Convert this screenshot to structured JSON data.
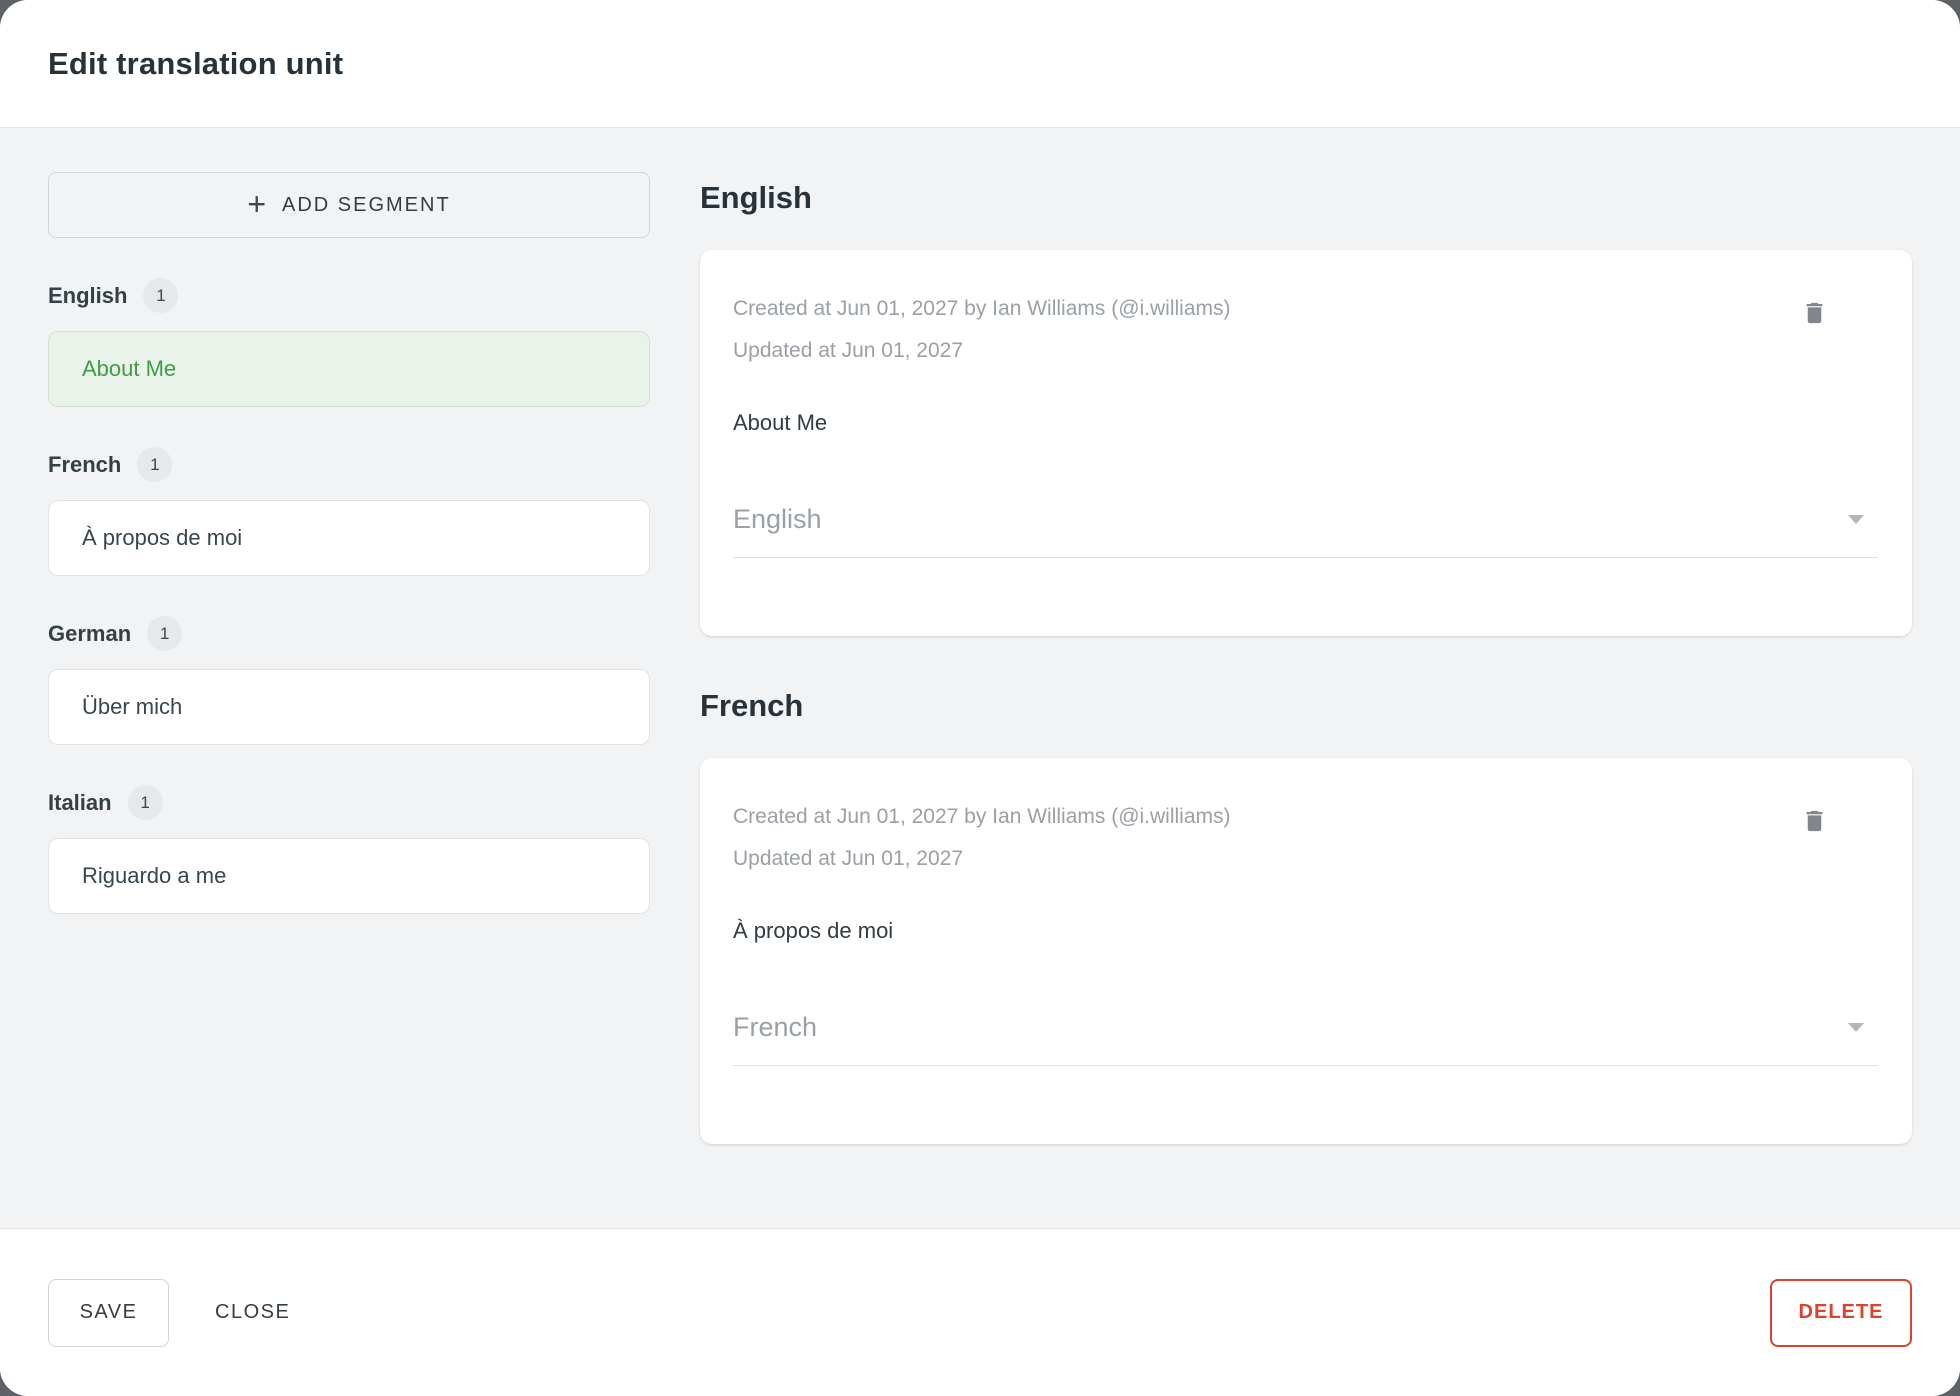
{
  "dialog": {
    "title": "Edit translation unit"
  },
  "sidebar": {
    "add_segment": {
      "icon": "+",
      "label": "ADD SEGMENT"
    },
    "groups": [
      {
        "language": "English",
        "count": "1",
        "segment": "About Me",
        "selected": true
      },
      {
        "language": "French",
        "count": "1",
        "segment": "À propos de moi",
        "selected": false
      },
      {
        "language": "German",
        "count": "1",
        "segment": "Über mich",
        "selected": false
      },
      {
        "language": "Italian",
        "count": "1",
        "segment": "Riguardo a me",
        "selected": false
      }
    ]
  },
  "main": {
    "sections": [
      {
        "heading": "English",
        "created_line": "Created at Jun 01, 2027 by Ian Williams (@i.williams)",
        "updated_line": "Updated at Jun 01, 2027",
        "text": "About Me",
        "language_select_value": "English"
      },
      {
        "heading": "French",
        "created_line": "Created at Jun 01, 2027 by Ian Williams (@i.williams)",
        "updated_line": "Updated at Jun 01, 2027",
        "text": "À propos de moi",
        "language_select_value": "French"
      }
    ]
  },
  "footer": {
    "save_label": "SAVE",
    "close_label": "CLOSE",
    "delete_label": "DELETE"
  },
  "colors": {
    "selected_segment_green": "#3f9d46",
    "selected_segment_bg": "#e9f3e9",
    "danger_red": "#d9432f",
    "body_gray": "#f1f3f4",
    "meta_gray": "#9aa0a6"
  }
}
